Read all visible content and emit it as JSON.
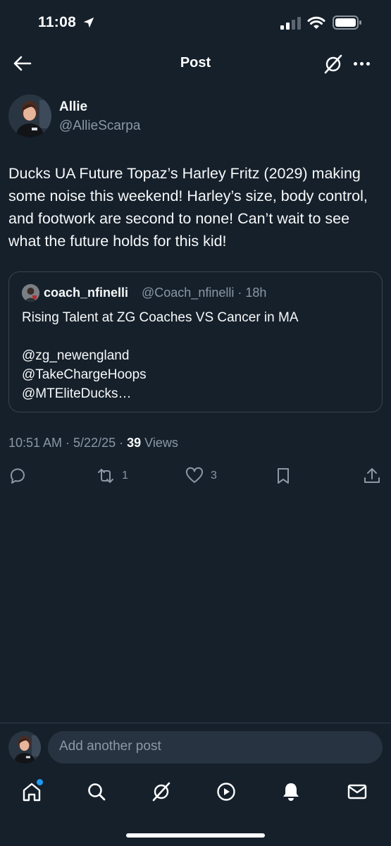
{
  "status_bar": {
    "time": "11:08"
  },
  "nav": {
    "title": "Post"
  },
  "post": {
    "author_name": "Allie",
    "author_handle": "@AllieScarpa",
    "text": "Ducks UA Future Topaz’s Harley Fritz (2029) making some noise this weekend! Harley’s size, body control, and footwork are second to none! Can’t wait to see what the future holds for this kid!",
    "timestamp": "10:51 AM · 5/22/25 · ",
    "views_count": "39",
    "views_label": " Views"
  },
  "quote": {
    "name": "coach_nfinelli",
    "handle_time": "@Coach_nfinelli · 18h",
    "lines": [
      "Rising Talent at ZG Coaches VS Cancer in MA",
      "",
      "@zg_newengland",
      "@TakeChargeHoops",
      "@MTEliteDucks…"
    ]
  },
  "actions": {
    "reply_count": "",
    "repost_count": "1",
    "like_count": "3"
  },
  "composer": {
    "placeholder": "Add another post"
  },
  "icons": {
    "back": "back-arrow-icon",
    "grok": "grok-icon",
    "more": "more-icon",
    "reply": "reply-icon",
    "repost": "repost-icon",
    "like": "heart-icon",
    "bookmark": "bookmark-icon",
    "share": "share-icon",
    "home": "home-icon",
    "search": "search-icon",
    "video": "play-icon",
    "notifications": "bell-icon",
    "messages": "mail-icon"
  },
  "colors": {
    "background": "#15202b",
    "text": "#f7f9f9",
    "muted": "#8b98a5",
    "border": "#38444d",
    "accent": "#1d9bf0"
  }
}
